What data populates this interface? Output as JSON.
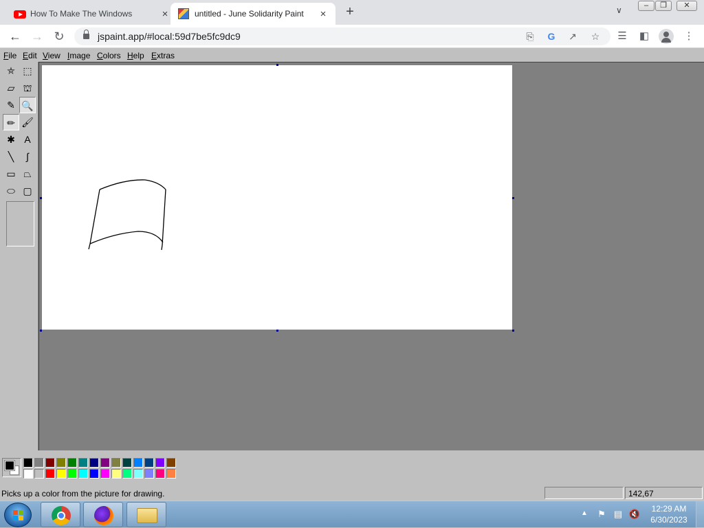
{
  "browser": {
    "tabs": [
      {
        "title": "How To Make The Windows Xp In",
        "favicon": "youtube-icon"
      },
      {
        "title": "untitled - June Solidarity Paint",
        "favicon": "paint-icon",
        "active": true
      }
    ],
    "new_tab": "+",
    "close_glyph": "×",
    "address": "jspaint.app/#local:59d7be5fc9dc9",
    "window_buttons": {
      "minimize": "–",
      "maximize": "❐",
      "close": "✕"
    }
  },
  "paint": {
    "menus": [
      {
        "label": "File",
        "key": "F",
        "rest": "ile"
      },
      {
        "label": "Edit",
        "key": "E",
        "rest": "dit"
      },
      {
        "label": "View",
        "key": "V",
        "rest": "iew"
      },
      {
        "label": "Image",
        "key": "I",
        "rest": "mage"
      },
      {
        "label": "Colors",
        "key": "C",
        "rest": "olors"
      },
      {
        "label": "Help",
        "key": "H",
        "rest": "elp"
      },
      {
        "label": "Extras",
        "key": "E",
        "rest": "xtras"
      }
    ],
    "tools": [
      {
        "name": "free-form-select",
        "glyph": "⛤"
      },
      {
        "name": "select",
        "glyph": "⬚"
      },
      {
        "name": "eraser",
        "glyph": "▱"
      },
      {
        "name": "fill-with-color",
        "glyph": "⛫"
      },
      {
        "name": "pick-color",
        "glyph": "✎",
        "pressed": false
      },
      {
        "name": "magnifier",
        "glyph": "🔍",
        "pressed": true
      },
      {
        "name": "pencil",
        "glyph": "✏",
        "pressed": true
      },
      {
        "name": "brush",
        "glyph": "🖌"
      },
      {
        "name": "airbrush",
        "glyph": "✱"
      },
      {
        "name": "text",
        "glyph": "A"
      },
      {
        "name": "line",
        "glyph": "╲"
      },
      {
        "name": "curve",
        "glyph": "∫"
      },
      {
        "name": "rectangle",
        "glyph": "▭"
      },
      {
        "name": "polygon",
        "glyph": "⏢"
      },
      {
        "name": "ellipse",
        "glyph": "⬭"
      },
      {
        "name": "rounded-rectangle",
        "glyph": "▢"
      }
    ],
    "colors": {
      "foreground": "#000000",
      "background": "#ffffff",
      "palette_top": [
        "#000000",
        "#808080",
        "#800000",
        "#808000",
        "#008000",
        "#008080",
        "#000080",
        "#800080",
        "#808040",
        "#004040",
        "#0080ff",
        "#004080",
        "#8000ff",
        "#804000"
      ],
      "palette_bottom": [
        "#ffffff",
        "#c0c0c0",
        "#ff0000",
        "#ffff00",
        "#00ff00",
        "#00ffff",
        "#0000ff",
        "#ff00ff",
        "#ffff80",
        "#00ff80",
        "#80ffff",
        "#8080ff",
        "#ff0080",
        "#ff8040"
      ]
    },
    "status": {
      "text": "Picks up a color from the picture for drawing.",
      "selection_size": "",
      "coordinates": "142,67"
    }
  },
  "taskbar": {
    "apps": [
      "chrome-icon",
      "firefox-icon",
      "explorer-icon"
    ],
    "tray_arrow": "▲",
    "time": "12:29 AM",
    "date": "6/30/2023"
  }
}
